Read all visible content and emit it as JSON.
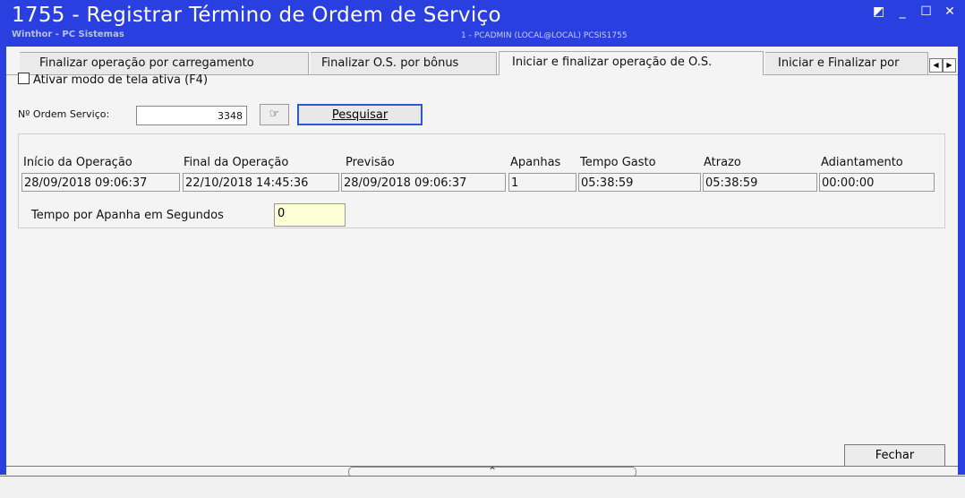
{
  "window": {
    "title": "1755 - Registrar Término de Ordem de Serviço",
    "subtitle": "Winthor - PC Sistemas",
    "center_info": "1 - PCADMIN (LOCAL@LOCAL)  PCSIS1755",
    "controls": {
      "restore": "◩",
      "minimize": "_",
      "maximize": "☐",
      "close": "✕"
    }
  },
  "tabs": [
    {
      "label": "Finalizar operação por carregamento"
    },
    {
      "label": "Finalizar O.S. por bônus"
    },
    {
      "label": "Iniciar e finalizar operação de O.S."
    },
    {
      "label": "Iniciar e Finalizar por"
    }
  ],
  "tab_scroll": {
    "left": "◀",
    "right": "▶"
  },
  "checkbox_label": "Ativar modo de tela ativa (F4)",
  "os": {
    "label": "Nº Ordem Serviço:",
    "value": "3348"
  },
  "lookup_icon_glyph": "☞",
  "search_label": "Pesquisar",
  "columns": [
    {
      "label": "Início da Operação",
      "value": "28/09/2018 09:06:37"
    },
    {
      "label": "Final da Operação",
      "value": "22/10/2018 14:45:36"
    },
    {
      "label": "Previsão",
      "value": "28/09/2018 09:06:37"
    },
    {
      "label": "Apanhas",
      "value": "1"
    },
    {
      "label": "Tempo Gasto",
      "value": "05:38:59"
    },
    {
      "label": "Atrazo",
      "value": "05:38:59"
    },
    {
      "label": "Adiantamento",
      "value": "00:00:00"
    }
  ],
  "tempo_apanha": {
    "label": "Tempo por Apanha em Segundos",
    "value": "0"
  },
  "close_label": "Fechar",
  "splitter_glyph": "^",
  "colors": {
    "titlebar": "#2a3fe0",
    "accent_button_border": "#2a5bd7",
    "highlight_input": "#ffffd5"
  }
}
